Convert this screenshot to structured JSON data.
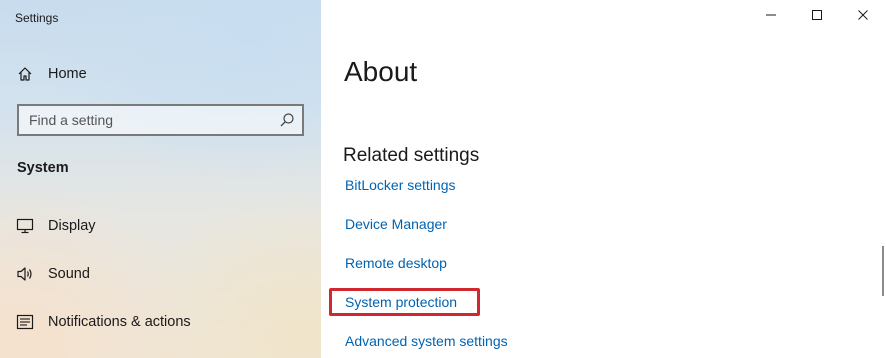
{
  "window": {
    "title": "Settings",
    "controls": {
      "minimize_icon": "minimize-icon",
      "maximize_icon": "maximize-icon",
      "close_icon": "close-icon"
    }
  },
  "sidebar": {
    "home": {
      "label": "Home",
      "icon": "home-icon"
    },
    "search": {
      "placeholder": "Find a setting",
      "value": "",
      "icon": "search-icon"
    },
    "section": "System",
    "items": [
      {
        "label": "Display",
        "icon": "monitor-icon"
      },
      {
        "label": "Sound",
        "icon": "speaker-icon"
      },
      {
        "label": "Notifications & actions",
        "icon": "notification-icon"
      }
    ]
  },
  "main": {
    "title": "About",
    "related": {
      "header": "Related settings",
      "links": [
        {
          "label": "BitLocker settings"
        },
        {
          "label": "Device Manager"
        },
        {
          "label": "Remote desktop"
        },
        {
          "label": "System protection",
          "highlighted": true
        },
        {
          "label": "Advanced system settings"
        }
      ]
    }
  },
  "colors": {
    "link": "#0063b1",
    "highlight": "#d1282f",
    "text": "#1a1a1a"
  }
}
